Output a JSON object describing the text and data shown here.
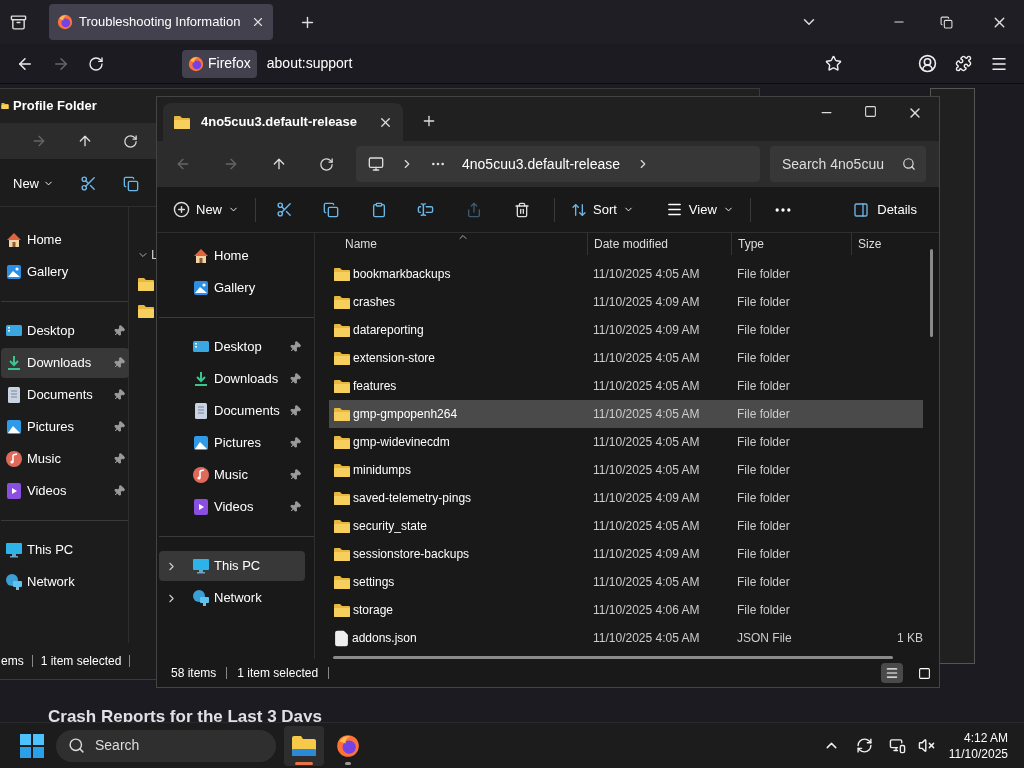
{
  "browser": {
    "tabs": [
      {
        "title": "Troubleshooting Information",
        "selected": true
      }
    ],
    "identity_label": "Firefox",
    "url": "about:support",
    "page_heading": "Crash Reports for the Last 3 Days"
  },
  "back_window": {
    "title": "Profile Folder",
    "new_label": "New",
    "list_group": "L",
    "sidebar": [
      [
        {
          "label": "Home",
          "kind": "home",
          "pinned": false,
          "selected": false
        },
        {
          "label": "Gallery",
          "kind": "gallery",
          "pinned": false,
          "selected": false
        }
      ],
      [
        {
          "label": "Desktop",
          "kind": "desktop",
          "pinned": true,
          "selected": false
        },
        {
          "label": "Downloads",
          "kind": "downloads",
          "pinned": true,
          "selected": true
        },
        {
          "label": "Documents",
          "kind": "documents",
          "pinned": true,
          "selected": false
        },
        {
          "label": "Pictures",
          "kind": "pictures",
          "pinned": true,
          "selected": false
        },
        {
          "label": "Music",
          "kind": "music",
          "pinned": true,
          "selected": false
        },
        {
          "label": "Videos",
          "kind": "videos",
          "pinned": true,
          "selected": false
        }
      ],
      [
        {
          "label": "This PC",
          "kind": "pc",
          "pinned": false,
          "selected": false
        },
        {
          "label": "Network",
          "kind": "network",
          "pinned": false,
          "selected": false
        }
      ]
    ],
    "status": [
      "ems",
      "1 item selected"
    ]
  },
  "explorer": {
    "tab_title": "4no5cuu3.default-release",
    "breadcrumb": "4no5cuu3.default-release",
    "search_placeholder": "Search 4no5cuu",
    "toolbar": {
      "new": "New",
      "sort": "Sort",
      "view": "View",
      "details": "Details"
    },
    "sidebar": [
      [
        {
          "label": "Home",
          "kind": "home",
          "pinned": false,
          "expandable": false,
          "selected": false
        },
        {
          "label": "Gallery",
          "kind": "gallery",
          "pinned": false,
          "expandable": false,
          "selected": false
        }
      ],
      [
        {
          "label": "Desktop",
          "kind": "desktop",
          "pinned": true,
          "expandable": false,
          "selected": false
        },
        {
          "label": "Downloads",
          "kind": "downloads",
          "pinned": true,
          "expandable": false,
          "selected": false
        },
        {
          "label": "Documents",
          "kind": "documents",
          "pinned": true,
          "expandable": false,
          "selected": false
        },
        {
          "label": "Pictures",
          "kind": "pictures",
          "pinned": true,
          "expandable": false,
          "selected": false
        },
        {
          "label": "Music",
          "kind": "music",
          "pinned": true,
          "expandable": false,
          "selected": false
        },
        {
          "label": "Videos",
          "kind": "videos",
          "pinned": true,
          "expandable": false,
          "selected": false
        }
      ],
      [
        {
          "label": "This PC",
          "kind": "pc",
          "pinned": false,
          "expandable": true,
          "selected": true
        },
        {
          "label": "Network",
          "kind": "network",
          "pinned": false,
          "expandable": true,
          "selected": false
        }
      ]
    ],
    "columns": [
      "Name",
      "Date modified",
      "Type",
      "Size"
    ],
    "rows": [
      {
        "name": "bookmarkbackups",
        "kind": "folder",
        "date": "11/10/2025 4:05 AM",
        "type": "File folder",
        "selected": false
      },
      {
        "name": "crashes",
        "kind": "folder",
        "date": "11/10/2025 4:09 AM",
        "type": "File folder",
        "selected": false
      },
      {
        "name": "datareporting",
        "kind": "folder",
        "date": "11/10/2025 4:09 AM",
        "type": "File folder",
        "selected": false
      },
      {
        "name": "extension-store",
        "kind": "folder",
        "date": "11/10/2025 4:05 AM",
        "type": "File folder",
        "selected": false
      },
      {
        "name": "features",
        "kind": "folder",
        "date": "11/10/2025 4:05 AM",
        "type": "File folder",
        "selected": false
      },
      {
        "name": "gmp-gmpopenh264",
        "kind": "folder",
        "date": "11/10/2025 4:05 AM",
        "type": "File folder",
        "selected": true
      },
      {
        "name": "gmp-widevinecdm",
        "kind": "folder",
        "date": "11/10/2025 4:05 AM",
        "type": "File folder",
        "selected": false
      },
      {
        "name": "minidumps",
        "kind": "folder",
        "date": "11/10/2025 4:05 AM",
        "type": "File folder",
        "selected": false
      },
      {
        "name": "saved-telemetry-pings",
        "kind": "folder",
        "date": "11/10/2025 4:09 AM",
        "type": "File folder",
        "selected": false
      },
      {
        "name": "security_state",
        "kind": "folder",
        "date": "11/10/2025 4:05 AM",
        "type": "File folder",
        "selected": false
      },
      {
        "name": "sessionstore-backups",
        "kind": "folder",
        "date": "11/10/2025 4:09 AM",
        "type": "File folder",
        "selected": false
      },
      {
        "name": "settings",
        "kind": "folder",
        "date": "11/10/2025 4:05 AM",
        "type": "File folder",
        "selected": false
      },
      {
        "name": "storage",
        "kind": "folder",
        "date": "11/10/2025 4:06 AM",
        "type": "File folder",
        "selected": false
      },
      {
        "name": "addons.json",
        "kind": "file",
        "date": "11/10/2025 4:05 AM",
        "type": "JSON File",
        "size": "1 KB",
        "selected": false
      }
    ],
    "status": [
      "58 items",
      "1 item selected"
    ],
    "view_buttons": [
      {
        "kind": "details",
        "selected": true
      },
      {
        "kind": "tiles",
        "selected": false
      }
    ]
  },
  "taskbar": {
    "search_placeholder": "Search",
    "time": "4:12 AM",
    "date": "11/10/2025",
    "apps": [
      {
        "kind": "explorer",
        "active": true
      },
      {
        "kind": "firefox",
        "active": false
      }
    ]
  }
}
